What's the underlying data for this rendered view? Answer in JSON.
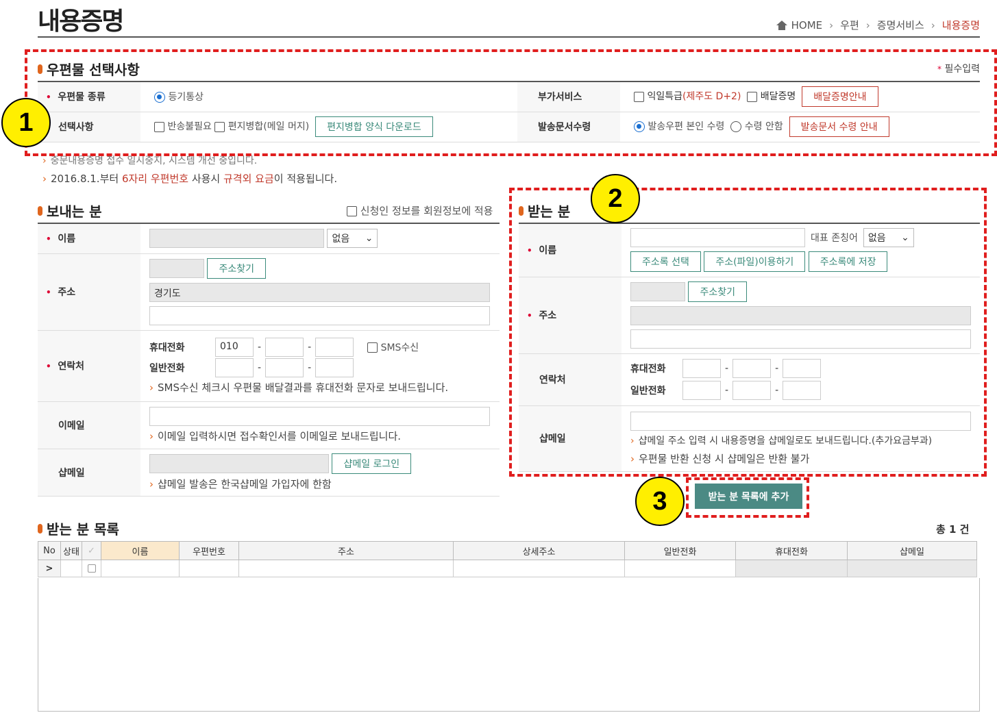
{
  "page": {
    "title": "내용증명",
    "breadcrumb": [
      "HOME",
      "우편",
      "증명서비스",
      "내용증명"
    ]
  },
  "section1": {
    "title": "우편물 선택사항",
    "required_note": "필수입력",
    "rows": {
      "mail_type_label": "우편물 종류",
      "mail_type_option": "등기통상",
      "extra_service_label": "부가서비스",
      "express_label": "익일특급",
      "express_note": "(제주도 D+2)",
      "delivery_proof_label": "배달증명",
      "delivery_guide_btn": "배달증명안내",
      "options_label": "선택사항",
      "return_label": "반송불필요",
      "merge_label": "편지병합(메일 머지)",
      "merge_download_btn": "편지병합 양식 다운로드",
      "doc_receive_label": "발송문서수령",
      "receive_self_label": "발송우편 본인 수령",
      "receive_none_label": "수령 안함",
      "doc_receive_guide_btn": "발송문서 수령 안내"
    }
  },
  "notices": {
    "n1": "중문내용증명 접수 일시중지, 시스템 개선 중입니다.",
    "n2_pre": "2016.8.1.부터 ",
    "n2_r1": "6자리 우편번호",
    "n2_mid": " 사용시 ",
    "n2_r2": "규격외 요금",
    "n2_post": "이 적용됩니다."
  },
  "sender": {
    "title": "보내는 분",
    "apply_member": "신청인 정보를 회원정보에 적용",
    "name_label": "이름",
    "name_select": "없음",
    "address_label": "주소",
    "find_address_btn": "주소찾기",
    "address_prefix": "경기도",
    "contact_label": "연락처",
    "mobile_label": "휴대전화",
    "mobile_prefix": "010",
    "sms_label": "SMS수신",
    "phone_label": "일반전화",
    "sms_note": "SMS수신 체크시 우편물 배달결과를 휴대전화 문자로 보내드립니다.",
    "email_label": "이메일",
    "email_note": "이메일 입력하시면 접수확인서를 이메일로 보내드립니다.",
    "shapmail_label": "샵메일",
    "shapmail_login_btn": "샵메일 로그인",
    "shapmail_note": "샵메일 발송은 한국샵메일 가입자에 한함"
  },
  "receiver": {
    "title": "받는 분",
    "name_label": "이름",
    "honorific_label": "대표 존칭어",
    "honorific_select": "없음",
    "address_book_btn": "주소록 선택",
    "address_file_btn": "주소(파일)이용하기",
    "save_address_btn": "주소록에 저장",
    "address_label": "주소",
    "find_address_btn": "주소찾기",
    "contact_label": "연락처",
    "mobile_label": "휴대전화",
    "phone_label": "일반전화",
    "shapmail_label": "샵메일",
    "shapmail_note1": "샵메일 주소 입력 시 내용증명을 샵메일로도 보내드립니다.(추가요금부과)",
    "shapmail_note2": "우편물 반환 신청 시 샵메일은 반환 불가"
  },
  "add_button": "받는 분 목록에 추가",
  "list": {
    "title": "받는 분 목록",
    "total": "총 1 건",
    "columns": [
      "No",
      "상태",
      "✓",
      "이름",
      "우편번호",
      "주소",
      "상세주소",
      "일반전화",
      "휴대전화",
      "샵메일"
    ],
    "row_marker": ">"
  },
  "annotations": [
    "1",
    "2",
    "3"
  ],
  "colors": {
    "accent_orange": "#e0661e",
    "button_teal": "#3a8a7a",
    "button_red": "#c0392b",
    "annotation_red": "#e01e1e",
    "badge_yellow": "#ffef00"
  }
}
